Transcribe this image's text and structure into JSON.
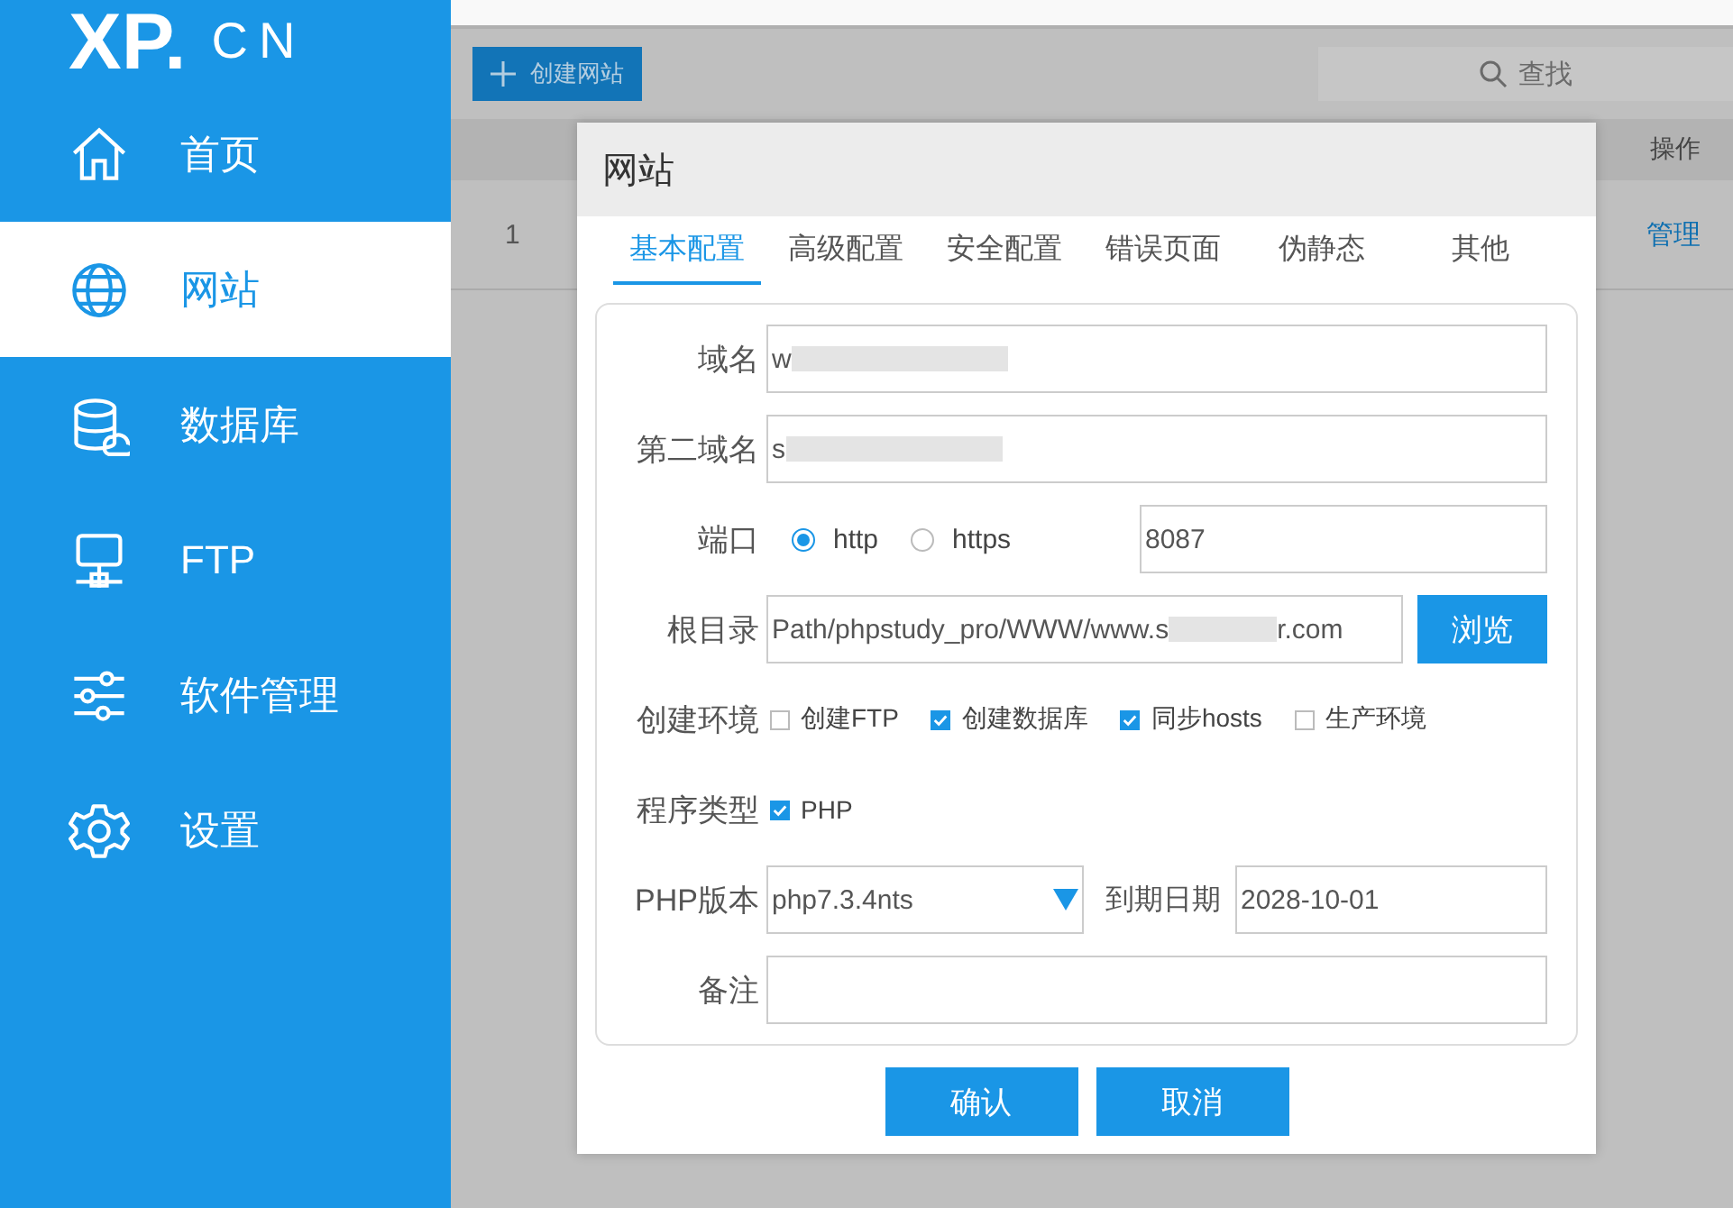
{
  "sidebar": {
    "logo": {
      "text": "XP.",
      "suffix": "CN"
    },
    "items": [
      {
        "label": "首页",
        "kind": "home",
        "selected": false
      },
      {
        "label": "网站",
        "kind": "globe",
        "selected": true
      },
      {
        "label": "数据库",
        "kind": "database",
        "selected": false
      },
      {
        "label": "FTP",
        "kind": "server",
        "selected": false
      },
      {
        "label": "软件管理",
        "kind": "sliders",
        "selected": false
      },
      {
        "label": "设置",
        "kind": "gear",
        "selected": false
      }
    ]
  },
  "main": {
    "create_button": "创建网站",
    "search": {
      "placeholder": "查找"
    },
    "table": {
      "columns": [
        "操作"
      ],
      "rows": [
        {
          "index": "1",
          "action": "管理"
        }
      ]
    }
  },
  "dialog": {
    "title": "网站",
    "tabs": [
      {
        "label": "基本配置",
        "selected": true
      },
      {
        "label": "高级配置",
        "selected": false
      },
      {
        "label": "安全配置",
        "selected": false
      },
      {
        "label": "错误页面",
        "selected": false
      },
      {
        "label": "伪静态",
        "selected": false
      },
      {
        "label": "其他",
        "selected": false
      }
    ],
    "fields": [
      {
        "kind": "text",
        "label": "域名",
        "value": "w",
        "redacted": true
      },
      {
        "kind": "text",
        "label": "第二域名",
        "value": "s",
        "redacted": true
      },
      {
        "kind": "port",
        "label": "端口",
        "options": [
          {
            "label": "http",
            "selected": true
          },
          {
            "label": "https",
            "selected": false
          }
        ],
        "value": "8087"
      },
      {
        "kind": "path",
        "label": "根目录",
        "value": "Path/phpstudy_pro/WWW/www.s",
        "value_end": "r.com",
        "redacted": true,
        "button": "浏览"
      },
      {
        "kind": "checks",
        "label": "创建环境",
        "options": [
          {
            "label": "创建FTP",
            "checked": false
          },
          {
            "label": "创建数据库",
            "checked": true
          },
          {
            "label": "同步hosts",
            "checked": true
          },
          {
            "label": "生产环境",
            "checked": false
          }
        ]
      },
      {
        "kind": "checks",
        "label": "程序类型",
        "options": [
          {
            "label": "PHP",
            "checked": true
          }
        ]
      },
      {
        "kind": "version",
        "label": "PHP版本",
        "value": "php7.3.4nts",
        "date_label": "到期日期",
        "date": "2028-10-01"
      },
      {
        "kind": "text",
        "label": "备注"
      }
    ],
    "buttons": [
      "确认",
      "取消"
    ]
  }
}
